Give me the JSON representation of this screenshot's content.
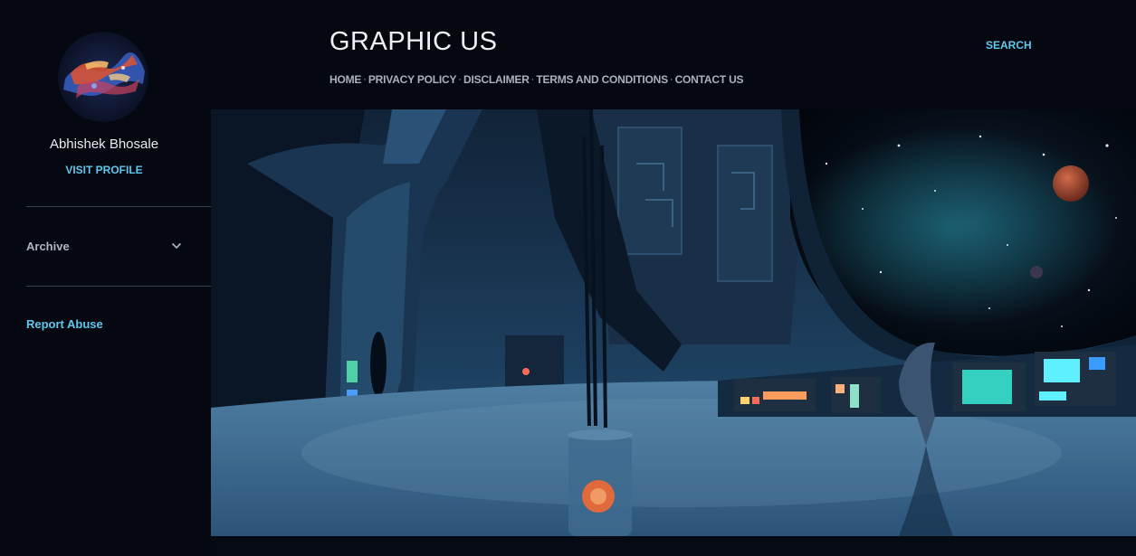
{
  "sidebar": {
    "profile": {
      "name": "Abhishek Bhosale",
      "visit_label": "VISIT PROFILE"
    },
    "archive_label": "Archive",
    "report_abuse_label": "Report Abuse"
  },
  "header": {
    "title": "GRAPHIC US",
    "search_label": "SEARCH",
    "nav": [
      {
        "label": "HOME"
      },
      {
        "label": "PRIVACY POLICY"
      },
      {
        "label": "DISCLAIMER"
      },
      {
        "label": "TERMS AND CONDITIONS"
      },
      {
        "label": "CONTACT US"
      }
    ],
    "nav_separator": "·"
  },
  "icons": {
    "archive_toggle": "chevron-down-icon"
  },
  "colors": {
    "background": "#050810",
    "accent": "#5fc8ee",
    "text": "#e8ecf2",
    "muted": "#b0b6c0"
  }
}
